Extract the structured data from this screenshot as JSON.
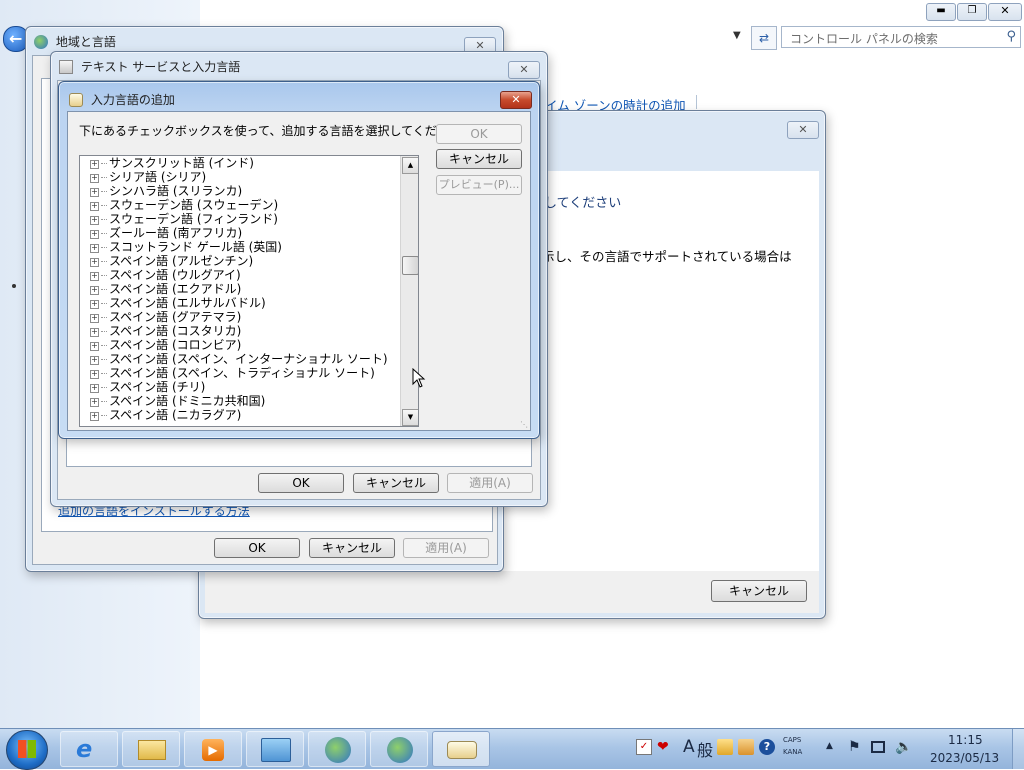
{
  "control_panel": {
    "search_placeholder": "コントロール パネルの検索",
    "link_timezone": "イム ゾーンの時計の追加",
    "text_select": "してください",
    "text_support": "示し、その言語でサポートされている場合は",
    "cancel_label": "キャンセル"
  },
  "region_dialog": {
    "title": "地域と言語",
    "link_install": "追加の言語をインストールする方法",
    "ok_label": "OK",
    "cancel_label": "キャンセル",
    "apply_label": "適用(A)"
  },
  "text_services_dialog": {
    "title": "テキスト サービスと入力言語",
    "ok_label": "OK",
    "cancel_label": "キャンセル",
    "apply_label": "適用(A)"
  },
  "add_language_dialog": {
    "title": "入力言語の追加",
    "instruction": "下にあるチェックボックスを使って、追加する言語を選択してください。",
    "ok_label": "OK",
    "cancel_label": "キャンセル",
    "preview_label": "プレビュー(P)...",
    "languages": [
      "サンスクリット語 (インド)",
      "シリア語 (シリア)",
      "シンハラ語 (スリランカ)",
      "スウェーデン語 (スウェーデン)",
      "スウェーデン語 (フィンランド)",
      "ズールー語 (南アフリカ)",
      "スコットランド ゲール語 (英国)",
      "スペイン語 (アルゼンチン)",
      "スペイン語 (ウルグアイ)",
      "スペイン語 (エクアドル)",
      "スペイン語 (エルサルバドル)",
      "スペイン語 (グアテマラ)",
      "スペイン語 (コスタリカ)",
      "スペイン語 (コロンビア)",
      "スペイン語 (スペイン、インターナショナル ソート)",
      "スペイン語 (スペイン、トラディショナル ソート)",
      "スペイン語 (チリ)",
      "スペイン語 (ドミニカ共和国)",
      "スペイン語 (ニカラグア)"
    ]
  },
  "taskbar": {
    "ime_mode": "A",
    "ime_kanji": "般",
    "caps": "CAPS",
    "kana": "KANA",
    "time": "11:15",
    "date": "2023/05/13"
  },
  "colors": {
    "accent_blue": "#0f56b4",
    "close_red": "#c74a2c",
    "taskbar": "#a9c5e6"
  }
}
